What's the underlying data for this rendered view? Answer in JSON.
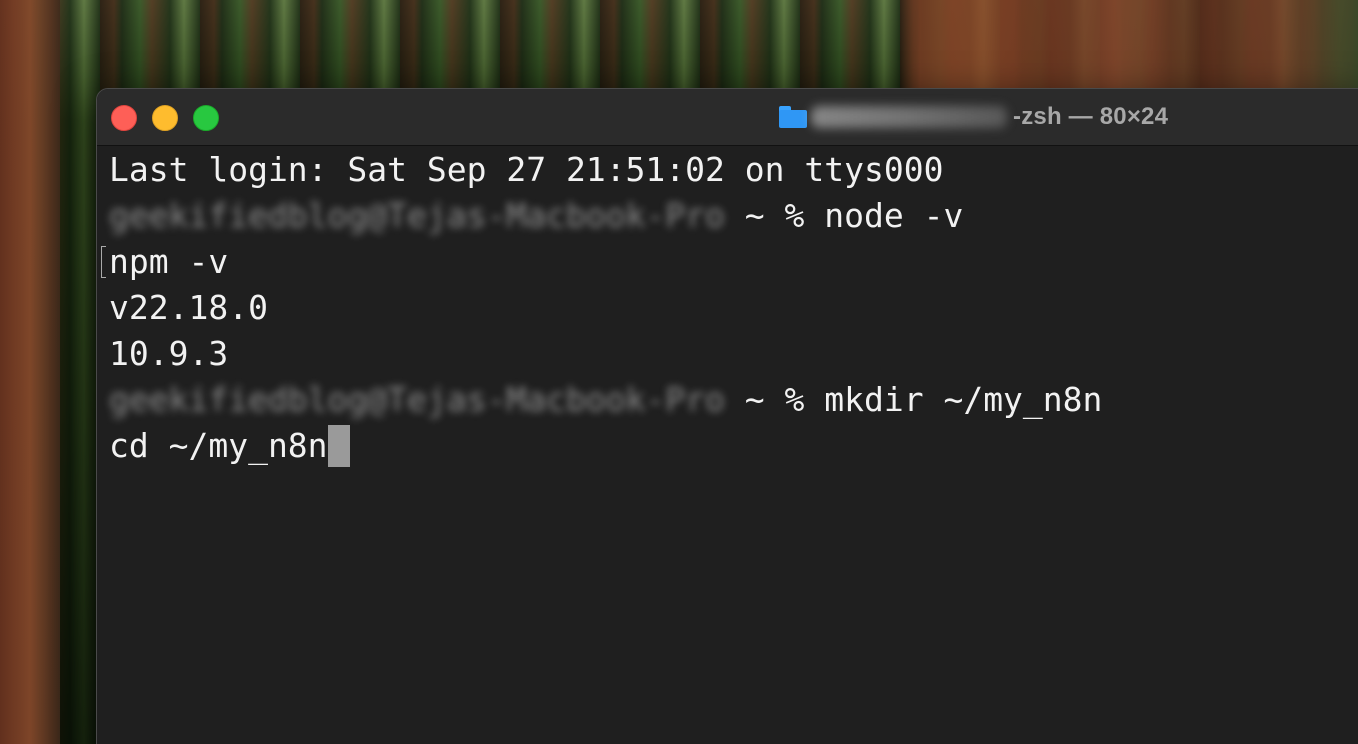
{
  "window": {
    "title": "-zsh — 80×24"
  },
  "terminal": {
    "lines": [
      "Last login: Sat Sep 27 21:51:02 on ttys000",
      "npm -v",
      "v22.18.0",
      "10.9.3",
      "cd ~/my_n8n"
    ],
    "prompt_user_blurred": "geekifiedblog@Tejas-Macbook-Pro",
    "prompt_suffix": " ~ % ",
    "commands": [
      "node -v",
      "mkdir ~/my_n8n"
    ]
  },
  "colors": {
    "close": "#fe5f57",
    "minimize": "#febc2e",
    "zoom": "#28c840",
    "terminal_bg": "#1f1f1f",
    "terminal_fg": "#f2f2f2"
  },
  "icons": [
    "close-button",
    "minimize-button",
    "zoom-button",
    "folder-icon"
  ]
}
